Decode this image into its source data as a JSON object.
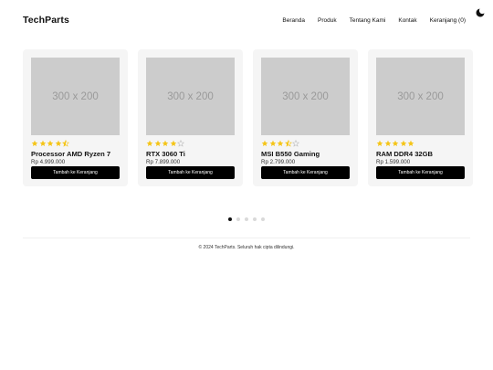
{
  "header": {
    "brand": "TechParts",
    "nav": [
      "Beranda",
      "Produk",
      "Tentang Kami",
      "Kontak",
      "Keranjang (0)"
    ],
    "theme_icon": "moon-icon"
  },
  "products": [
    {
      "image_placeholder": "300 x 200",
      "rating": 4.5,
      "name": "Processor AMD Ryzen 7",
      "price": "Rp 4.999.000",
      "button": "Tambah ke Keranjang"
    },
    {
      "image_placeholder": "300 x 200",
      "rating": 4,
      "name": "RTX 3060 Ti",
      "price": "Rp 7.899.000",
      "button": "Tambah ke Keranjang"
    },
    {
      "image_placeholder": "300 x 200",
      "rating": 3.5,
      "name": "MSI B550 Gaming",
      "price": "Rp 2.799.000",
      "button": "Tambah ke Keranjang"
    },
    {
      "image_placeholder": "300 x 200",
      "rating": 5,
      "name": "RAM DDR4 32GB",
      "price": "Rp 1.599.000",
      "button": "Tambah ke Keranjang"
    }
  ],
  "pagination": {
    "total": 5,
    "active": 0
  },
  "footer": {
    "text": "© 2024 TechParts. Seluruh hak cipta dilindungi."
  },
  "colors": {
    "star": "#f5c518",
    "star_empty": "#bdbdbd",
    "button": "#000000",
    "card": "#f5f5f5",
    "image": "#cccccc"
  }
}
